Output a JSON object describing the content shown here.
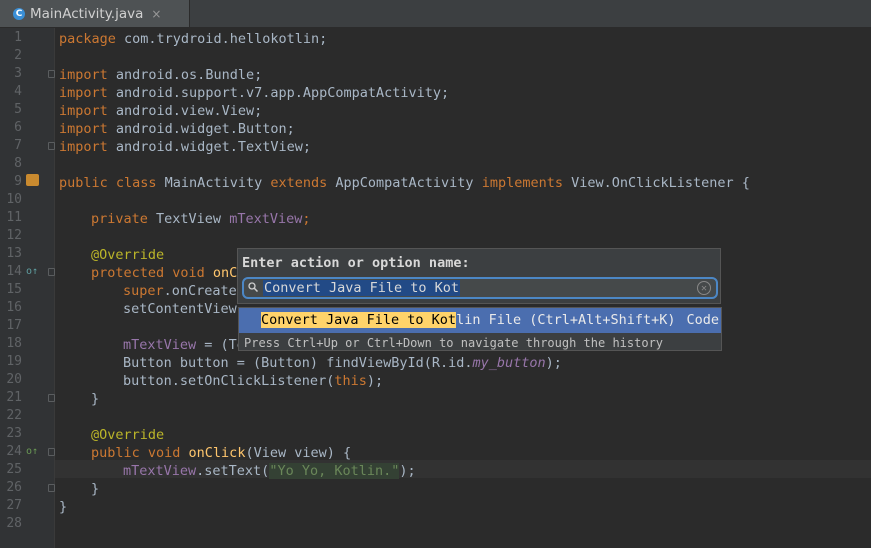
{
  "tab": {
    "icon": "C",
    "label": "MainActivity.java",
    "close": "×"
  },
  "line_numbers": [
    "1",
    "2",
    "3",
    "4",
    "5",
    "6",
    "7",
    "8",
    "9",
    "10",
    "11",
    "12",
    "13",
    "14",
    "15",
    "16",
    "17",
    "18",
    "19",
    "20",
    "21",
    "22",
    "23",
    "24",
    "25",
    "26",
    "27",
    "28"
  ],
  "code": {
    "l1a": "package",
    "l1b": " com.trydroid.hellokotlin;",
    "l3a": "import",
    "l3b": " android.os.Bundle;",
    "l4a": "import",
    "l4b": " android.support.v7.app.AppCompatActivity;",
    "l5a": "import",
    "l5b": " android.view.View;",
    "l6a": "import",
    "l6b": " android.widget.Button;",
    "l7a": "import",
    "l7b": " android.widget.TextView;",
    "l9a": "public class",
    "l9b": " MainActivity ",
    "l9c": "extends",
    "l9d": " AppCompatActivity ",
    "l9e": "implements",
    "l9f": " View.OnClickListener {",
    "l11a": "private",
    "l11b": " TextView ",
    "l11c": "mTextView",
    "l11d": ";",
    "l13": "@Override",
    "l14a": "protected void",
    "l14b": " onC",
    "l15a": "super",
    "l15b": ".onCreate",
    "l16": "setContentView",
    "l18a": "mTextView",
    "l18b": " = (Te",
    "l19a": "Button button = (Button) findViewById(R.id.",
    "l19b": "my_button",
    "l19c": ");",
    "l20a": "button.setOnClickListener(",
    "l20b": "this",
    "l20c": ");",
    "l21": "}",
    "l23": "@Override",
    "l24a": "public void",
    "l24b": "onClick",
    "l24c": "(View view) {",
    "l25a": "mTextView",
    "l25b": ".setText(",
    "l25c": "\"Yo Yo, Kotlin.\"",
    "l25d": ");",
    "l26": "}",
    "l27": "}"
  },
  "popup": {
    "title": "Enter action or option name:",
    "search_value": "Convert Java File to Kot",
    "result_match": "Convert Java File to Kot",
    "result_rest": "lin File (Ctrl+Alt+Shift+K)",
    "result_category": "Code",
    "hint": "Press Ctrl+Up or Ctrl+Down to navigate through the history"
  },
  "icons": {
    "tab": "class-icon",
    "search": "search-icon",
    "clear": "clear-icon",
    "gutter_9": "class-marker-icon",
    "gutter_14": "override-marker-icon",
    "gutter_24": "implement-marker-icon"
  }
}
